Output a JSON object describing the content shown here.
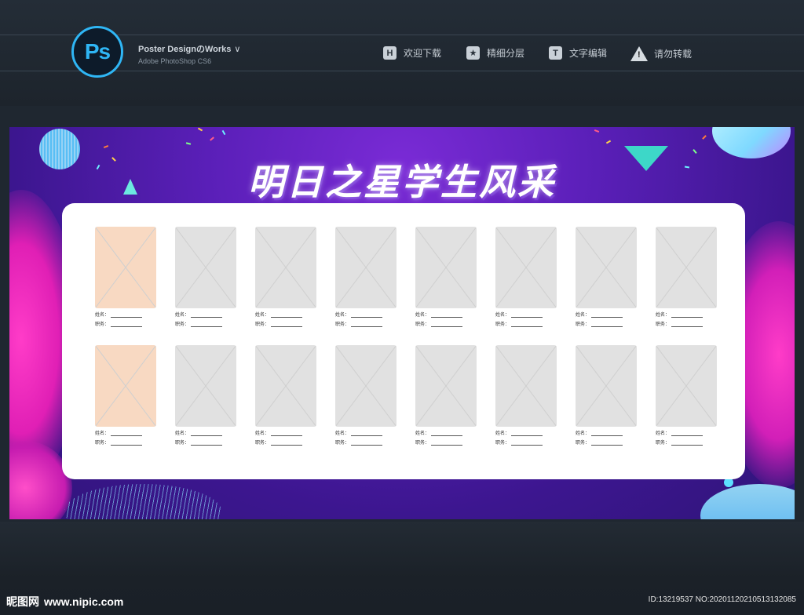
{
  "header": {
    "logo_text": "Ps",
    "brand_title": "Poster DesignのWorks",
    "brand_chevron": "∨",
    "brand_subtitle": "Adobe PhotoShop CS6",
    "nav": [
      {
        "icon": "H",
        "label": "欢迎下载"
      },
      {
        "icon": "★",
        "label": "精细分层"
      },
      {
        "icon": "T",
        "label": "文字编辑"
      },
      {
        "icon": "!",
        "label": "请勿转载"
      }
    ]
  },
  "poster": {
    "title": "明日之星学生风采",
    "field_name_label": "姓名：",
    "field_position_label": "职务：",
    "rows": 2,
    "columns": 8,
    "colors": {
      "background": "#5a1fb8",
      "photo_placeholder": "#e1e1e1",
      "photo_highlight": "#f8d9c2",
      "board": "#ffffff"
    }
  },
  "footer": {
    "watermark_logo": "昵图网",
    "watermark_url": "www.nipic.com",
    "id_text": "ID:13219537 NO:20201120210513132085"
  }
}
